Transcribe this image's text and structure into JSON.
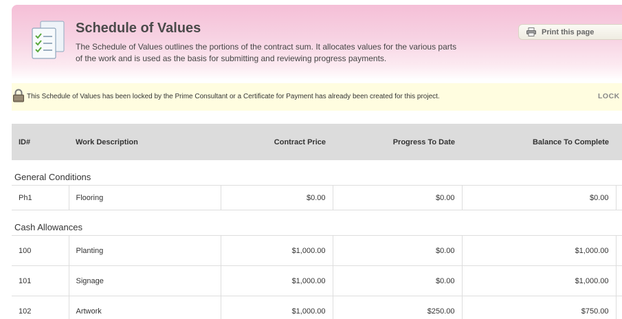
{
  "header": {
    "title": "Schedule of Values",
    "description": "The Schedule of Values outlines the portions of the contract sum. It allocates values for the various parts of the work and is used as the basis for submitting and reviewing progress payments.",
    "print_label": "Print this page"
  },
  "notice": {
    "text": "This Schedule of Values has been locked by the Prime Consultant or a Certificate for Payment has already been created for this project.",
    "lock_label": "LOCK"
  },
  "table": {
    "columns": {
      "id": "ID#",
      "description": "Work Description",
      "contract_price": "Contract Price",
      "progress": "Progress To Date",
      "balance": "Balance To Complete"
    },
    "groups": [
      {
        "name": "General Conditions",
        "rows": [
          {
            "id": "Ph1",
            "description": "Flooring",
            "contract_price": "$0.00",
            "progress": "$0.00",
            "balance": "$0.00"
          }
        ]
      },
      {
        "name": "Cash Allowances",
        "rows": [
          {
            "id": "100",
            "description": "Planting",
            "contract_price": "$1,000.00",
            "progress": "$0.00",
            "balance": "$1,000.00"
          },
          {
            "id": "101",
            "description": "Signage",
            "contract_price": "$1,000.00",
            "progress": "$0.00",
            "balance": "$1,000.00"
          },
          {
            "id": "102",
            "description": "Artwork",
            "contract_price": "$1,000.00",
            "progress": "$250.00",
            "balance": "$750.00"
          }
        ]
      }
    ]
  },
  "colors": {
    "header_pink": "#f5bfd7",
    "notice_yellow": "#fffde0",
    "table_header_gray": "#dcdcdc"
  }
}
